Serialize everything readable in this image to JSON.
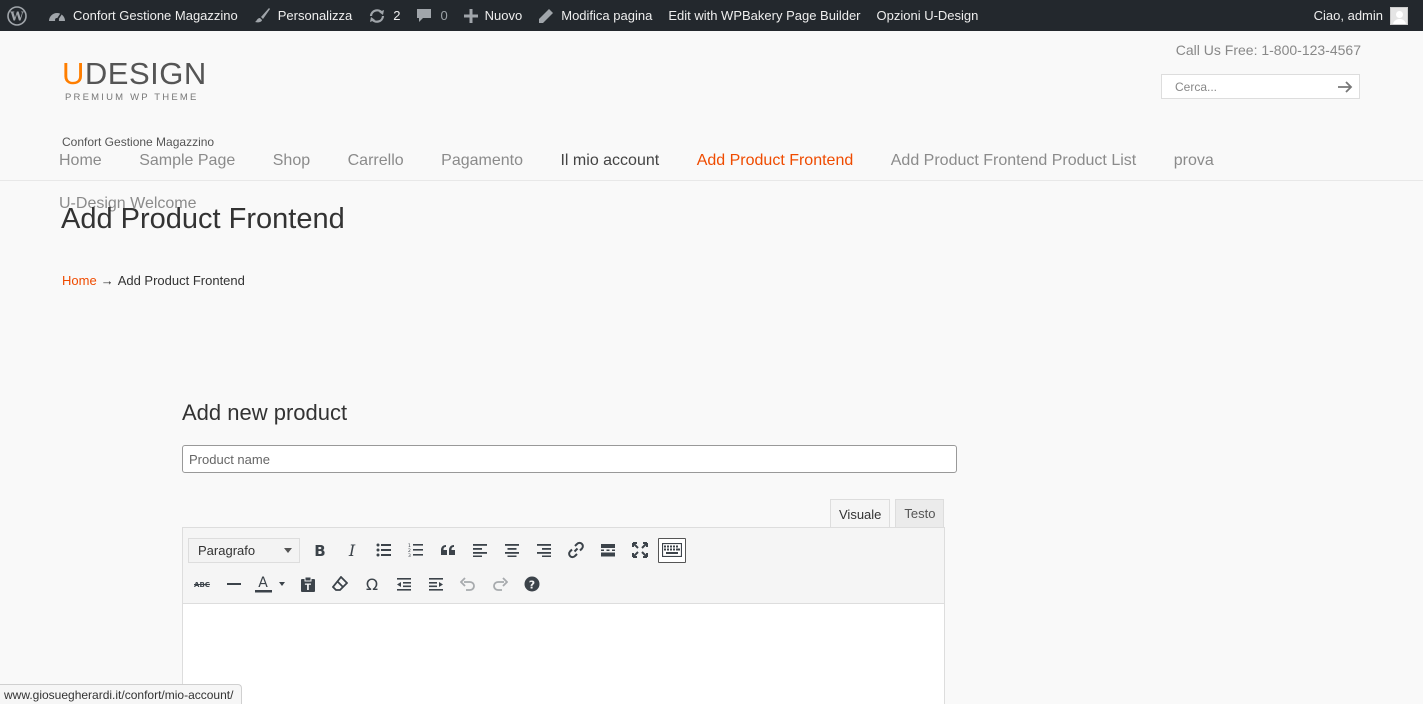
{
  "adminbar": {
    "site_name": "Confort Gestione Magazzino",
    "customize": "Personalizza",
    "updates_count": "2",
    "comments_count": "0",
    "new": "Nuovo",
    "edit_page": "Modifica pagina",
    "wpbakery": "Edit with WPBakery Page Builder",
    "udesign_options": "Opzioni U-Design",
    "greeting": "Ciao, admin"
  },
  "header": {
    "logo_u": "U",
    "logo_rest": "DESIGN",
    "logo_sub": "PREMIUM WP THEME",
    "call_us": "Call Us Free: 1-800-123-4567",
    "search_placeholder": "Cerca...",
    "tagline": "Confort Gestione Magazzino"
  },
  "nav": {
    "items": [
      {
        "label": "Home"
      },
      {
        "label": "Sample Page"
      },
      {
        "label": "Shop"
      },
      {
        "label": "Carrello"
      },
      {
        "label": "Pagamento"
      },
      {
        "label": "Il mio account"
      },
      {
        "label": "Add Product Frontend"
      },
      {
        "label": "Add Product Frontend Product List"
      },
      {
        "label": "prova"
      }
    ],
    "hover_label": "U-Design Welcome"
  },
  "page": {
    "title": "Add Product Frontend",
    "breadcrumb_home": "Home",
    "breadcrumb_sep": "→",
    "breadcrumb_current": "Add Product Frontend"
  },
  "form": {
    "title": "Add new product",
    "product_name_placeholder": "Product name",
    "tab_visual": "Visuale",
    "tab_text": "Testo",
    "format_select": "Paragrafo"
  },
  "status_url": "www.giosuegherardi.it/confort/mio-account/",
  "colors": {
    "accent": "#ef4b00",
    "logo_orange": "#ff7e00",
    "adminbar_bg": "#23282d"
  }
}
